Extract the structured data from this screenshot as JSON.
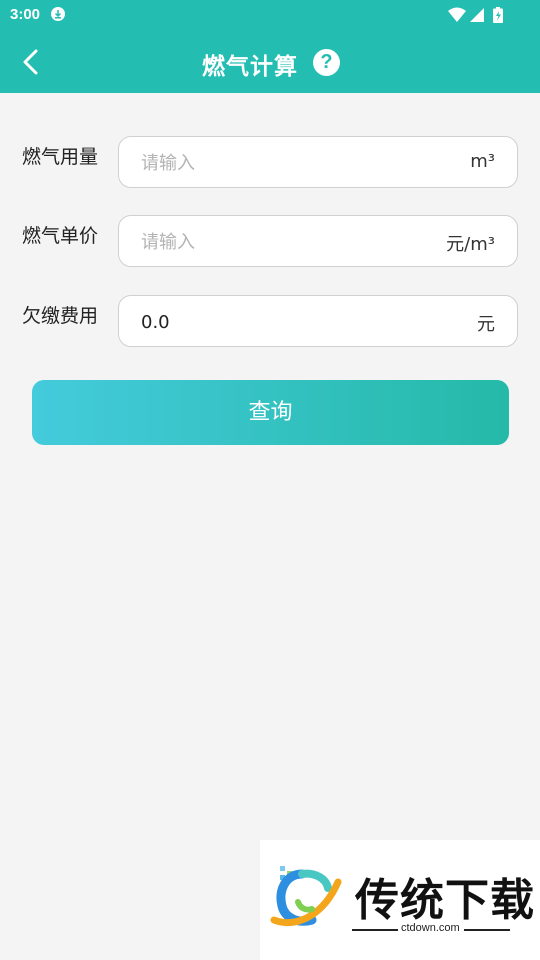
{
  "status_bar": {
    "time": "3:00",
    "icons": [
      "download-icon",
      "wifi-icon",
      "signal-icon",
      "battery-icon"
    ]
  },
  "app_bar": {
    "title": "燃气计算",
    "help_label": "?",
    "back_icon": "back-arrow-icon"
  },
  "form": {
    "usage": {
      "label": "燃气用量",
      "placeholder": "请输入",
      "value": "",
      "unit": "m³"
    },
    "price": {
      "label": "燃气单价",
      "placeholder": "请输入",
      "value": "",
      "unit": "元/m³"
    },
    "arrears": {
      "label": "欠缴费用",
      "placeholder": "",
      "value": "0.0",
      "unit": "元"
    }
  },
  "query_button": {
    "label": "查询"
  },
  "watermark": {
    "brand": "传统下载",
    "domain": "ctdown.com"
  },
  "colors": {
    "primary": "#24bdb1",
    "button_gradient_start": "#44cbdc",
    "button_gradient_end": "#25b9a8",
    "background": "#f4f4f4"
  }
}
